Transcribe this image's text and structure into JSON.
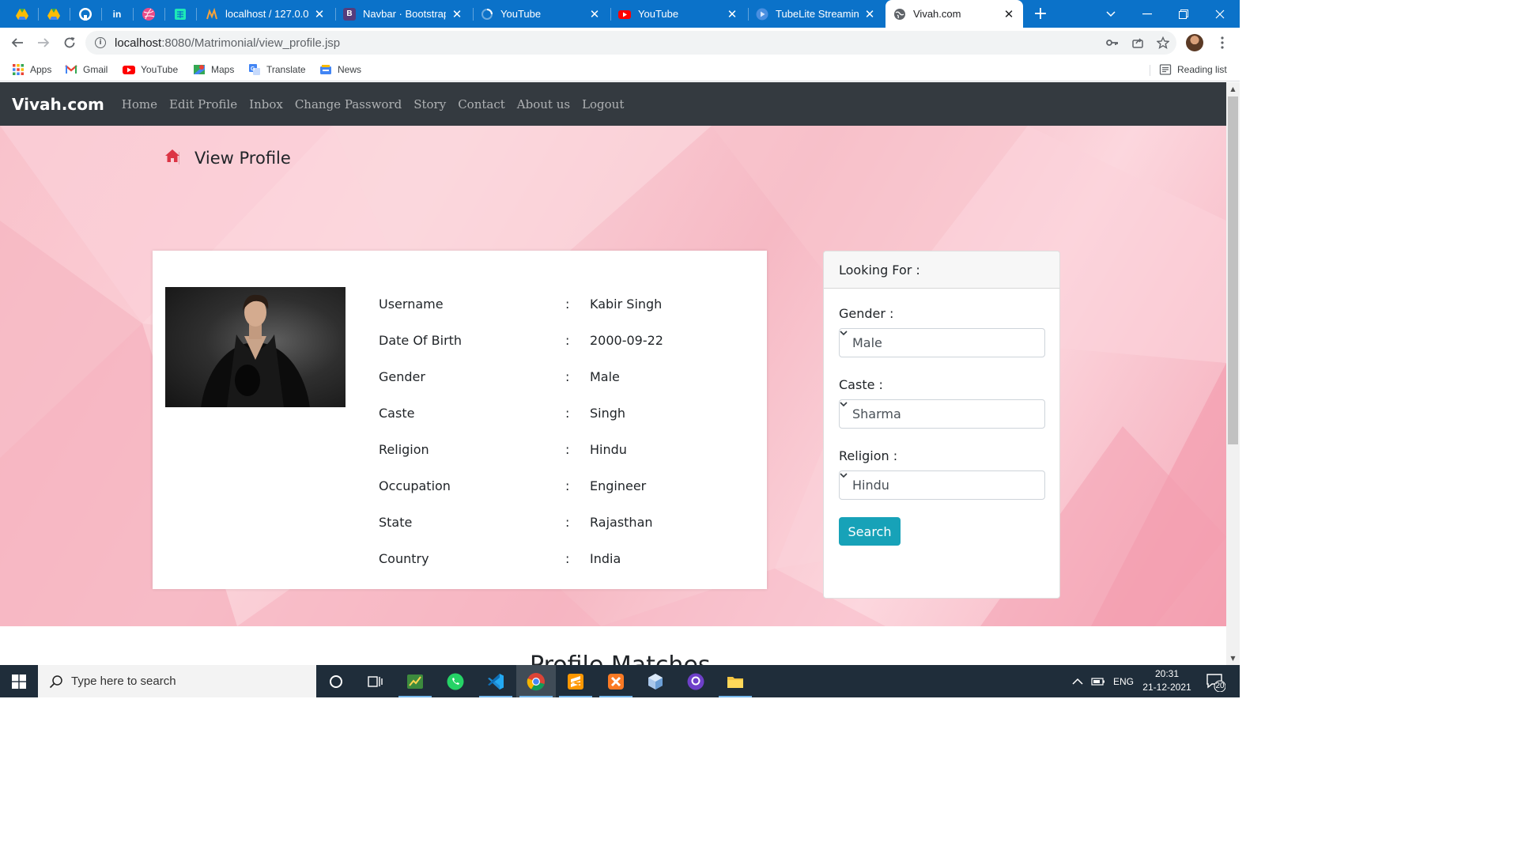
{
  "browser": {
    "tabs": [
      {
        "title": "localhost / 127.0.0.1",
        "icon": "phpmyadmin-icon"
      },
      {
        "title": "Navbar · Bootstrap v",
        "icon": "bootstrap-icon"
      },
      {
        "title": "YouTube",
        "icon": "youtube-loading-icon"
      },
      {
        "title": "YouTube",
        "icon": "youtube-icon"
      },
      {
        "title": "TubeLite Streaming",
        "icon": "tubelite-icon"
      },
      {
        "title": "Vivah.com",
        "icon": "globe-icon",
        "active": true
      }
    ],
    "url_host": "localhost",
    "url_path": ":8080/Matrimonial/view_profile.jsp",
    "bookmarks": [
      "Apps",
      "Gmail",
      "YouTube",
      "Maps",
      "Translate",
      "News"
    ],
    "reading_list": "Reading list"
  },
  "site": {
    "brand": "Vivah.com",
    "nav": [
      "Home",
      "Edit Profile",
      "Inbox",
      "Change Password",
      "Story",
      "Contact",
      "About us",
      "Logout"
    ],
    "breadcrumb_title": "View Profile",
    "profile": [
      {
        "label": "Username",
        "value": "Kabir Singh"
      },
      {
        "label": "Date Of Birth",
        "value": "2000-09-22"
      },
      {
        "label": "Gender",
        "value": "Male"
      },
      {
        "label": "Caste",
        "value": "Singh"
      },
      {
        "label": "Religion",
        "value": "Hindu"
      },
      {
        "label": "Occupation",
        "value": "Engineer"
      },
      {
        "label": "State",
        "value": "Rajasthan"
      },
      {
        "label": "Country",
        "value": "India"
      }
    ],
    "separator": ":",
    "filter": {
      "heading": "Looking For :",
      "gender_label": "Gender :",
      "gender_value": "Male",
      "caste_label": "Caste :",
      "caste_value": "Sharma",
      "religion_label": "Religion :",
      "religion_value": "Hindu",
      "search_label": "Search"
    },
    "next_section_title": "Profile Matches",
    "accent": "#17a2b8",
    "nav_bg": "#343a40",
    "home_icon_color": "#dc3545"
  },
  "taskbar": {
    "search_placeholder": "Type here to search",
    "language": "ENG",
    "time": "20:31",
    "date": "21-12-2021",
    "notification_count": "20"
  }
}
